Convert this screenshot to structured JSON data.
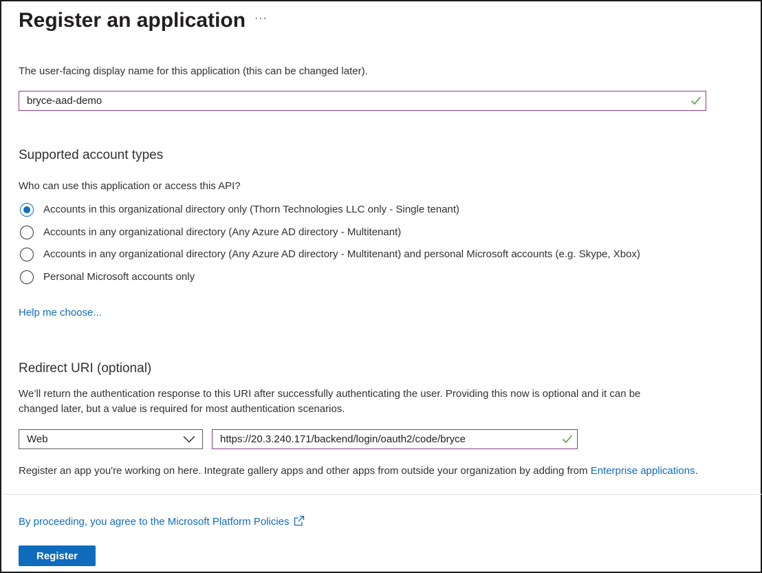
{
  "page": {
    "title": "Register an application",
    "more_label": "···"
  },
  "name_section": {
    "description": "The user-facing display name for this application (this can be changed later).",
    "value": "bryce-aad-demo"
  },
  "account_types": {
    "heading": "Supported account types",
    "question": "Who can use this application or access this API?",
    "options": [
      {
        "label": "Accounts in this organizational directory only (Thorn Technologies LLC only - Single tenant)",
        "selected": true
      },
      {
        "label": "Accounts in any organizational directory (Any Azure AD directory - Multitenant)",
        "selected": false
      },
      {
        "label": "Accounts in any organizational directory (Any Azure AD directory - Multitenant) and personal Microsoft accounts (e.g. Skype, Xbox)",
        "selected": false
      },
      {
        "label": "Personal Microsoft accounts only",
        "selected": false
      }
    ],
    "help_link": "Help me choose..."
  },
  "redirect": {
    "heading": "Redirect URI (optional)",
    "description_line1": "We’ll return the authentication response to this URI after successfully authenticating the user. Providing this now is optional and it can be",
    "description_line2": "changed later, but a value is required for most authentication scenarios.",
    "platform_value": "Web",
    "uri_value": "https://20.3.240.171/backend/login/oauth2/code/bryce"
  },
  "gallery_note": {
    "text": "Register an app you're working on here. Integrate gallery apps and other apps from outside your organization by adding from ",
    "link": "Enterprise applications",
    "suffix": "."
  },
  "footer": {
    "policy_link": "By proceeding, you agree to the Microsoft Platform Policies",
    "register_label": "Register"
  },
  "colors": {
    "accent": "#0f6cbd",
    "valid_border": "#8a3a8c",
    "check": "#4fa33a"
  }
}
